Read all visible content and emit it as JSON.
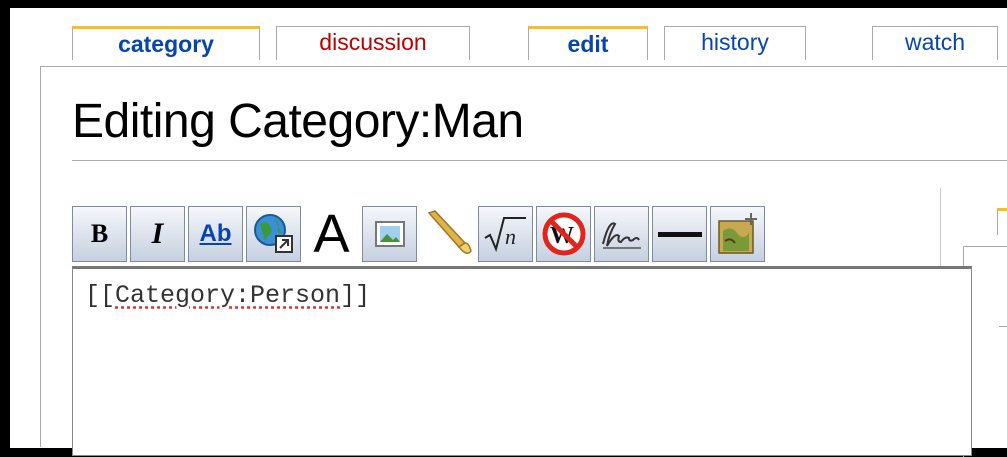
{
  "tabs": [
    {
      "label": "category"
    },
    {
      "label": "discussion"
    },
    {
      "label": "edit"
    },
    {
      "label": "history"
    },
    {
      "label": "watch"
    }
  ],
  "page": {
    "title": "Editing Category:Man"
  },
  "toolbar": {
    "buttons": [
      {
        "icon": "bold-icon",
        "glyph": "B"
      },
      {
        "icon": "italic-icon",
        "glyph": "I"
      },
      {
        "icon": "internal-link-icon",
        "glyph": "Ab"
      },
      {
        "icon": "external-link-icon"
      },
      {
        "icon": "headline-icon",
        "glyph": "A"
      },
      {
        "icon": "embedded-image-icon"
      },
      {
        "icon": "media-file-icon"
      },
      {
        "icon": "math-formula-icon"
      },
      {
        "icon": "nowiki-icon"
      },
      {
        "icon": "signature-icon"
      },
      {
        "icon": "horizontal-line-icon"
      },
      {
        "icon": "insert-map-icon"
      }
    ]
  },
  "editor": {
    "prefix": "[[",
    "link_target": "Category:Person",
    "suffix": "]]"
  },
  "colors": {
    "link": "#0645ad",
    "redlink": "#ba0000",
    "selected_tab_accent": "#fabd23"
  }
}
